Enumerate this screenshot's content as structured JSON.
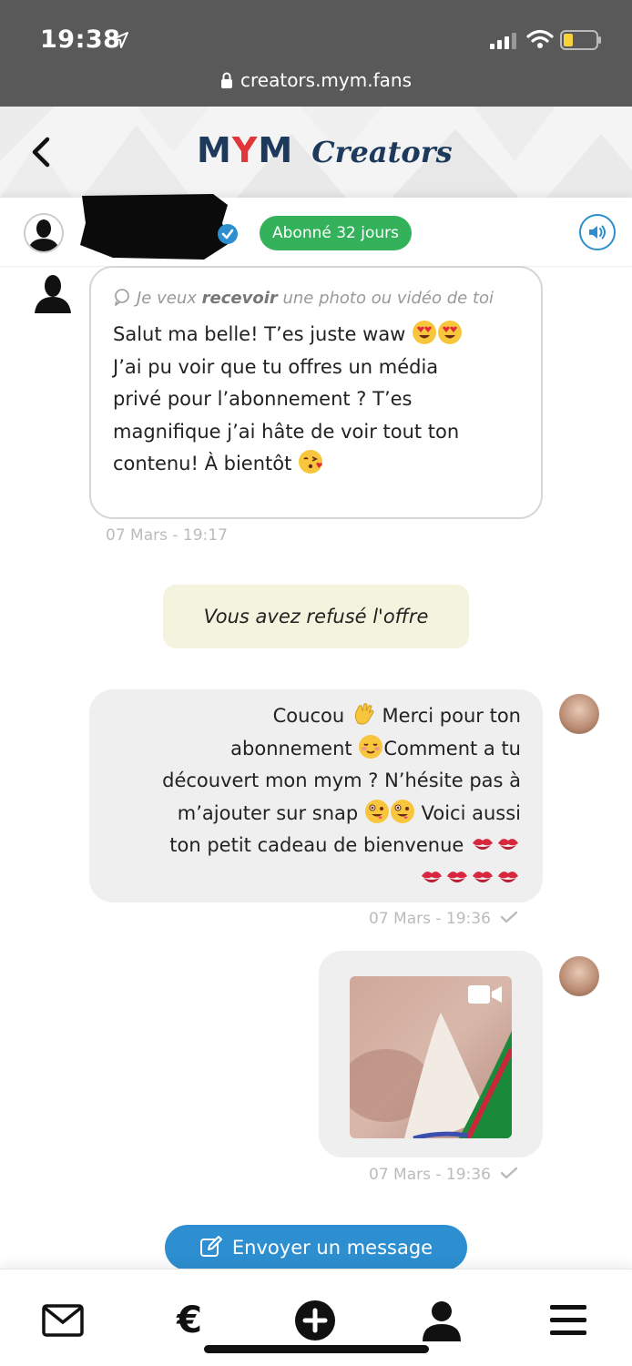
{
  "status_bar": {
    "time": "19:38"
  },
  "browser": {
    "url": "creators.mym.fans"
  },
  "header": {
    "logo_mym": "MYM",
    "logo_mym_parts": [
      "M",
      "Y",
      "M"
    ],
    "logo_creators": "Creators",
    "brand_navy": "#1d3a5c",
    "brand_red": "#e1363a"
  },
  "profile": {
    "subscription_badge": "Abonné 32 jours",
    "badge_color": "#34b15b"
  },
  "messages": {
    "incoming": {
      "request_prefix": "Je veux ",
      "request_bold": "recevoir",
      "request_suffix": " une photo ou vidéo de toi",
      "line1": "Salut ma belle! T’es juste waw",
      "line2": "J’ai pu voir que tu offres un média",
      "line3": "privé pour l’abonnement ? T’es",
      "line4": "magnifique j’ai hâte de voir tout ton",
      "line5": "contenu! À bientôt",
      "timestamp": "07 Mars - 19:17"
    },
    "refused_notice": "Vous avez refusé l'offre",
    "outgoing_text": {
      "line1": "Coucou",
      "line1b": "Merci pour ton",
      "line2": "abonnement",
      "line2b": "Comment a tu",
      "line3": "découvert mon mym ? N’hésite pas à",
      "line4": "m’ajouter sur snap",
      "line4b": "Voici aussi",
      "line5": "ton petit cadeau de bienvenue",
      "timestamp": "07 Mars - 19:36"
    },
    "outgoing_video": {
      "timestamp": "07 Mars - 19:36"
    }
  },
  "send_button": {
    "label": "Envoyer un message",
    "color": "#2d8fd0"
  },
  "bottom_nav": {
    "items": [
      {
        "icon": "mail-icon"
      },
      {
        "icon": "euro-icon",
        "glyph": "€"
      },
      {
        "icon": "plus-circle-icon"
      },
      {
        "icon": "user-icon"
      },
      {
        "icon": "menu-icon"
      }
    ]
  }
}
